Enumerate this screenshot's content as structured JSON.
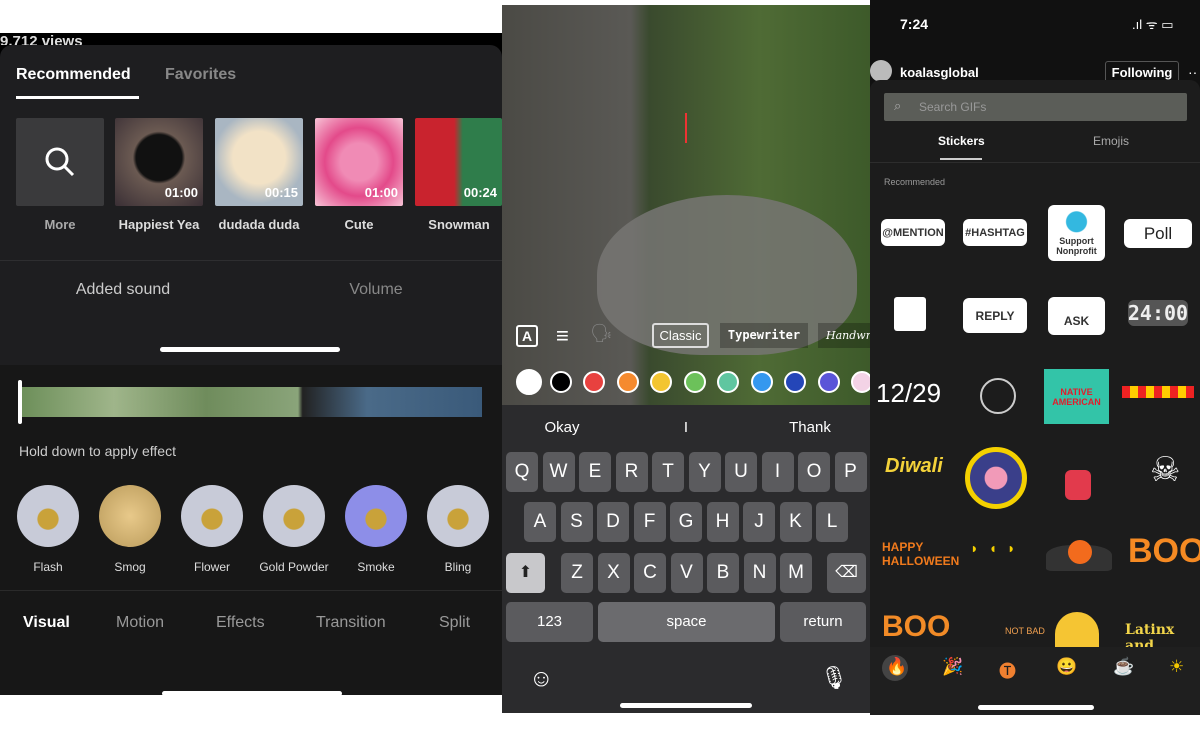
{
  "left": {
    "views": "9,712 views",
    "tabs": [
      "Recommended",
      "Favorites"
    ],
    "sounds": [
      {
        "label": "More",
        "icon": "search-icon"
      },
      {
        "label": "Happiest Yea",
        "duration": "01:00"
      },
      {
        "label": "dudada duda",
        "duration": "00:15"
      },
      {
        "label": "Cute",
        "duration": "01:00"
      },
      {
        "label": "Snowman",
        "duration": "00:24"
      }
    ],
    "sound_tabs": [
      "Added sound",
      "Volume"
    ],
    "hint": "Hold down to apply effect",
    "effects": [
      "Flash",
      "Smog",
      "Flower",
      "Gold Powder",
      "Smoke",
      "Bling"
    ],
    "bottom_tabs": [
      "Visual",
      "Motion",
      "Effects",
      "Transition",
      "Split"
    ]
  },
  "middle": {
    "fonts": [
      "Classic",
      "Typewriter",
      "Handwriting"
    ],
    "colors": [
      "#ffffff",
      "#000000",
      "#e8413f",
      "#f58a2e",
      "#f3c531",
      "#6cc15a",
      "#5fc6a0",
      "#3498ef",
      "#2446b8",
      "#5a55d8",
      "#f3d3e6"
    ],
    "suggestions": [
      "Okay",
      "I",
      "Thank"
    ],
    "rows": [
      [
        "Q",
        "W",
        "E",
        "R",
        "T",
        "Y",
        "U",
        "I",
        "O",
        "P"
      ],
      [
        "A",
        "S",
        "D",
        "F",
        "G",
        "H",
        "J",
        "K",
        "L"
      ],
      [
        "Z",
        "X",
        "C",
        "V",
        "B",
        "N",
        "M"
      ]
    ],
    "keys": {
      "numbers": "123",
      "space": "space",
      "return": "return"
    }
  },
  "right": {
    "time": "7:24",
    "username": "koalasglobal",
    "following": "Following",
    "search_placeholder": "Search GIFs",
    "tabs": [
      "Stickers",
      "Emojis"
    ],
    "section": "Recommended",
    "stickers": {
      "mention": "@MENTION",
      "hashtag": "#HASHTAG",
      "nonprofit": "Support Nonprofit",
      "poll": "Poll",
      "reply": "REPLY",
      "ask": "ASK",
      "countdown": "24:00",
      "date": "12/29",
      "native": "NATIVE AMERICAN",
      "diwali": "Diwali",
      "halloween": "HAPPY HALLOWEEN",
      "boo": "BOO",
      "boo2": "BOO",
      "notbad": "NOT BAD",
      "latinx": "Latinx and"
    },
    "categories": [
      "🔥",
      "🎉",
      "🅣",
      "😀",
      "☕",
      "☀"
    ]
  }
}
